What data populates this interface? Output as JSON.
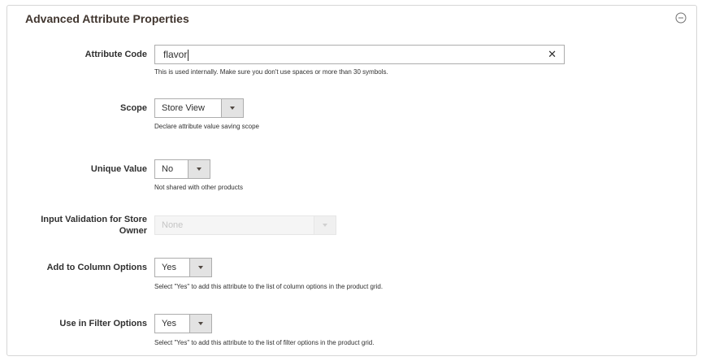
{
  "panel": {
    "title": "Advanced Attribute Properties"
  },
  "fields": {
    "attribute_code": {
      "label": "Attribute Code",
      "value": "flavor",
      "clear": "✕",
      "note": "This is used internally. Make sure you don't use spaces or more than 30 symbols."
    },
    "scope": {
      "label": "Scope",
      "value": "Store View",
      "note": "Declare attribute value saving scope"
    },
    "unique_value": {
      "label": "Unique Value",
      "value": "No",
      "note": "Not shared with other products"
    },
    "input_validation": {
      "label_line1": "Input Validation for Store",
      "label_line2": "Owner",
      "value": "None"
    },
    "add_to_column": {
      "label": "Add to Column Options",
      "value": "Yes",
      "note": "Select \"Yes\" to add this attribute to the list of column options in the product grid."
    },
    "use_in_filter": {
      "label": "Use in Filter Options",
      "value": "Yes",
      "note": "Select \"Yes\" to add this attribute to the list of filter options in the product grid."
    }
  },
  "icons": {
    "collapse": "collapse-circle-icon",
    "dropdown": "chevron-down-icon"
  },
  "colors": {
    "border": "#adadad",
    "label": "#303030",
    "arrow_bg": "#e3e3e3"
  }
}
